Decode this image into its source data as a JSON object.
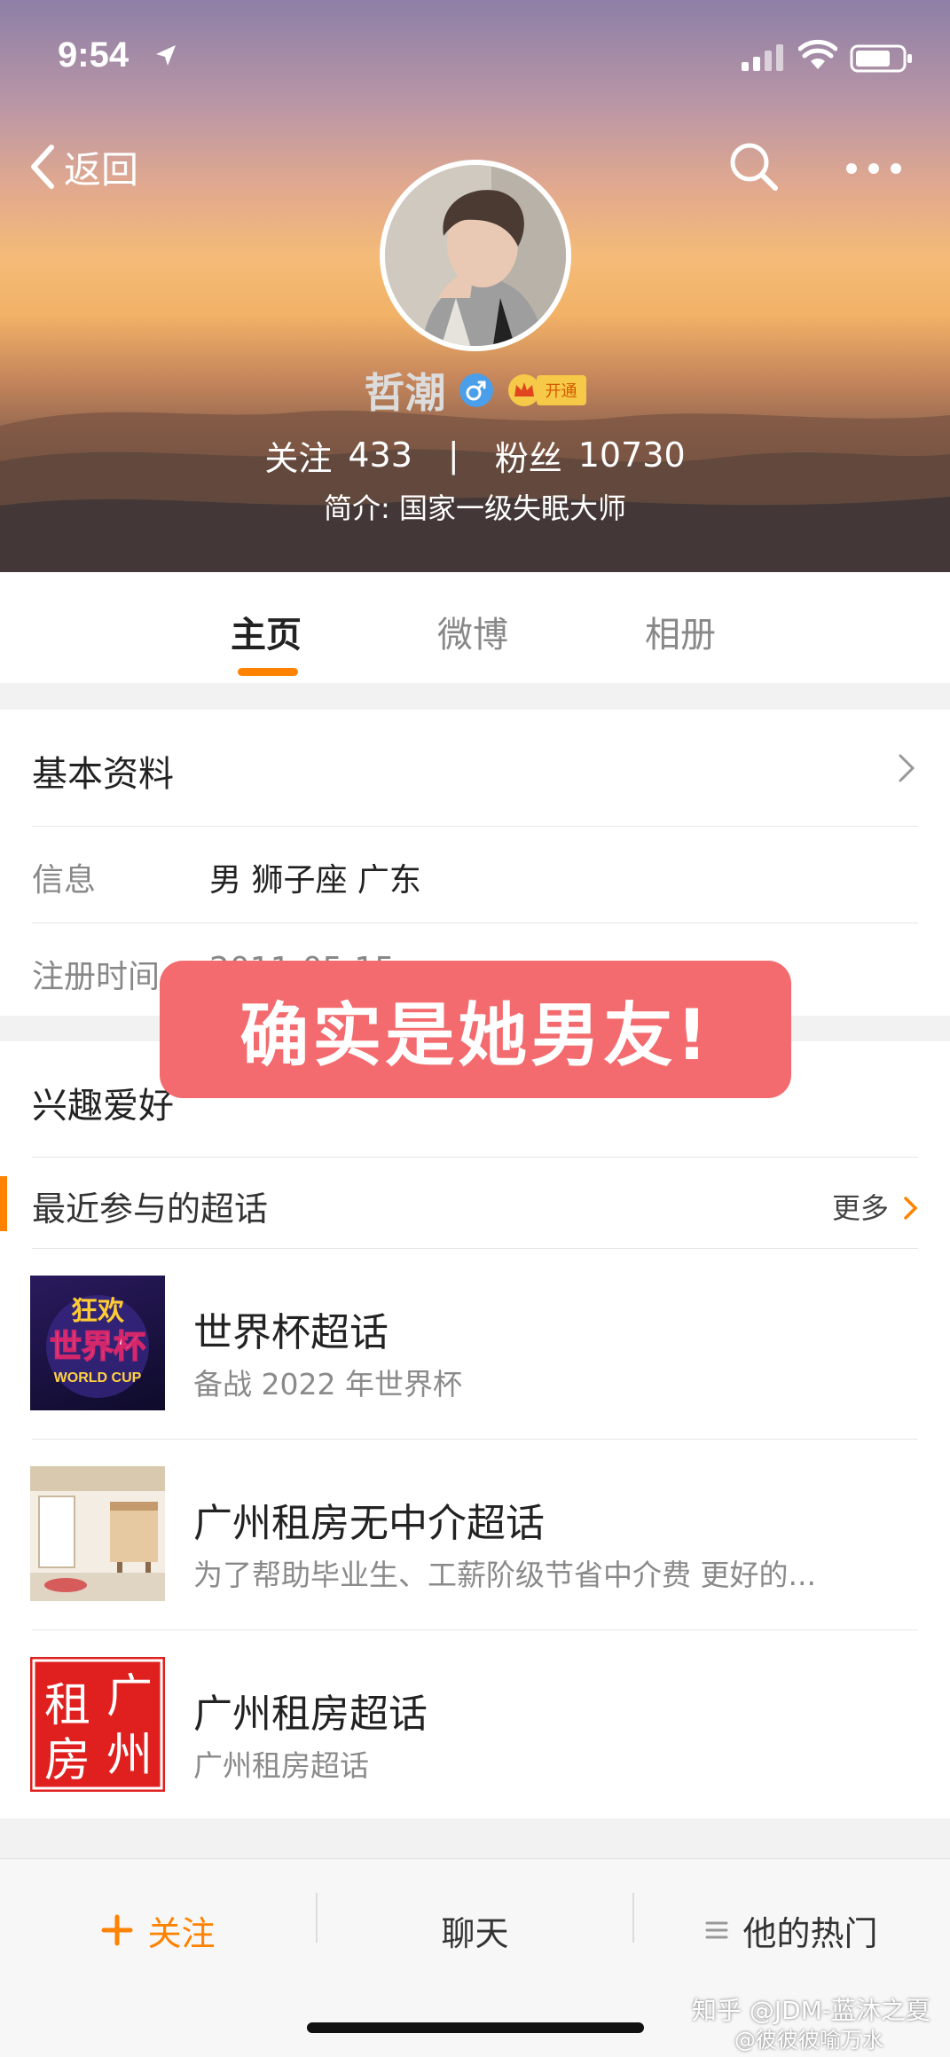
{
  "status_bar": {
    "time": "9:54"
  },
  "nav": {
    "back_label": "返回"
  },
  "profile": {
    "name": "哲潮",
    "vip_tag": "开通",
    "following_label": "关注",
    "following_count": "433",
    "separator": "|",
    "followers_label": "粉丝",
    "followers_count": "10730",
    "bio": "简介: 国家一级失眠大师"
  },
  "tabs": [
    {
      "label": "主页",
      "active": true
    },
    {
      "label": "微博",
      "active": false
    },
    {
      "label": "相册",
      "active": false
    }
  ],
  "basic_info": {
    "title": "基本资料",
    "info_label": "信息",
    "info_value": "男  狮子座  广东",
    "reg_label": "注册时间",
    "reg_value": "2011-05-15"
  },
  "interest": {
    "title": "兴趣爱好",
    "recent_title": "最近参与的超话",
    "more_label": "更多",
    "items": [
      {
        "title": "世界杯超话",
        "desc": "备战 2022 年世界杯",
        "thumb_lines": [
          "狂欢",
          "世界杯",
          "WORLD CUP"
        ]
      },
      {
        "title": "广州租房无中介超话",
        "desc": "为了帮助毕业生、工薪阶级节省中介费 更好的..."
      },
      {
        "title": "广州租房超话",
        "desc": "广州租房超话",
        "thumb_chars": [
          "广",
          "租",
          "州",
          "房"
        ]
      }
    ]
  },
  "overlay_text": "确实是她男友!",
  "bottom_bar": {
    "follow_label": "关注",
    "chat_label": "聊天",
    "hot_label": "他的热门"
  },
  "watermark": {
    "line1": "知乎 @JDM-蓝沐之夏",
    "line2": "@彼彼彼喻万水"
  },
  "colors": {
    "accent": "#ff8200",
    "overlay": "#f36b6e",
    "vip": "#f7c948"
  }
}
